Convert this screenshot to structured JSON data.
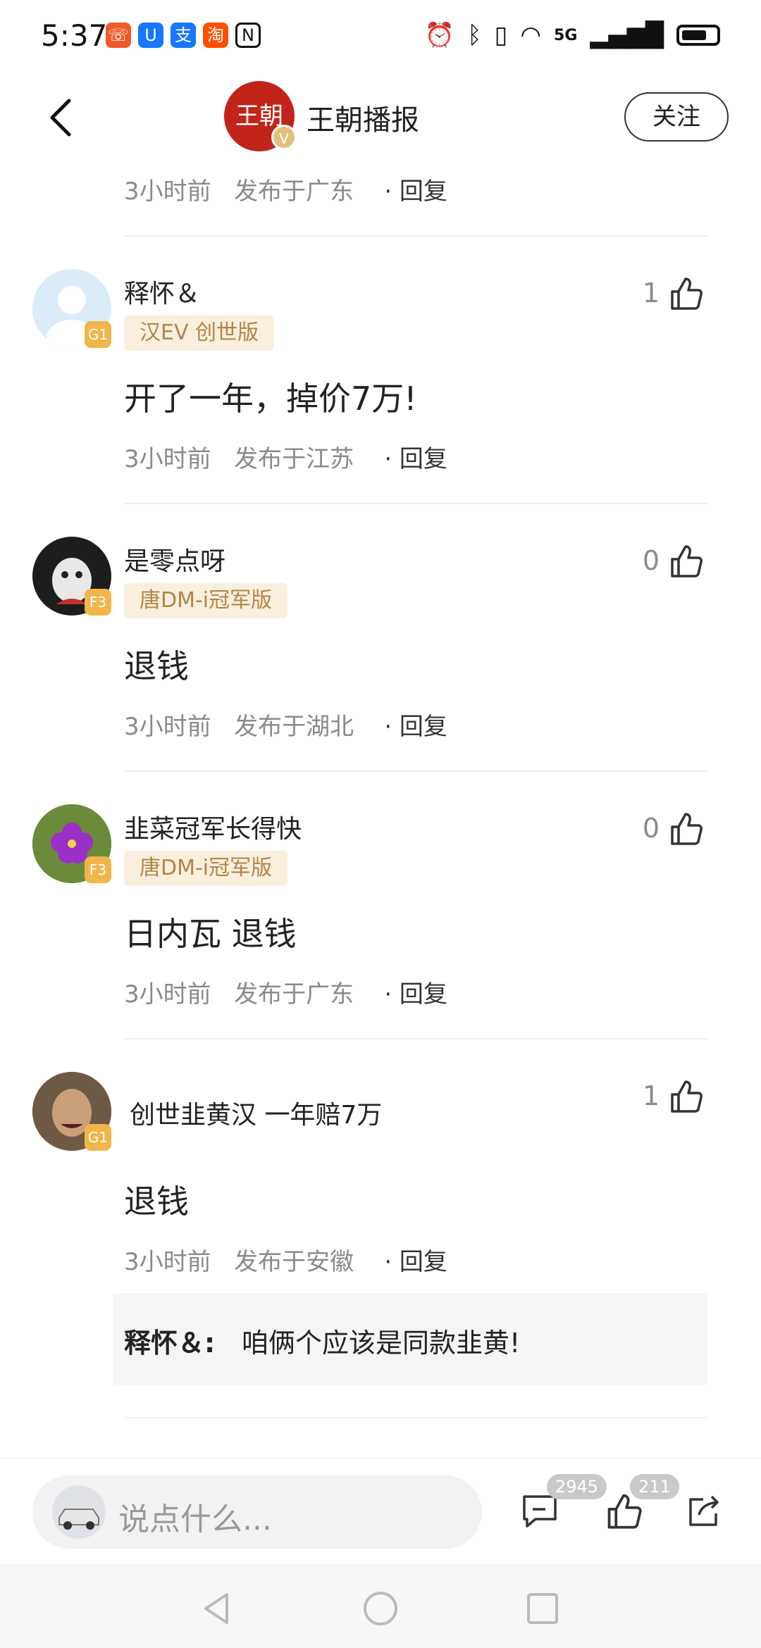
{
  "status_bar": {
    "time": "5:37",
    "network": "5G"
  },
  "header": {
    "author_name": "王朝播报",
    "avatar_text": "王朝",
    "badge": "V",
    "follow_label": "关注"
  },
  "comments": [
    {
      "username": "",
      "car_tag": "",
      "text": "",
      "time": "3小时前",
      "location": "发布于广东",
      "reply_label": "· 回复",
      "likes": ""
    },
    {
      "username": "释怀＆",
      "level": "G1",
      "car_tag": "汉EV 创世版",
      "text": "开了一年，掉价7万!",
      "time": "3小时前",
      "location": "发布于江苏",
      "reply_label": "· 回复",
      "likes": "1"
    },
    {
      "username": "是零点呀",
      "level": "F3",
      "car_tag": "唐DM-i冠军版",
      "text": "退钱",
      "time": "3小时前",
      "location": "发布于湖北",
      "reply_label": "· 回复",
      "likes": "0"
    },
    {
      "username": "韭菜冠军长得快",
      "level": "F3",
      "car_tag": "唐DM-i冠军版",
      "text": "日内瓦 退钱",
      "time": "3小时前",
      "location": "发布于广东",
      "reply_label": "· 回复",
      "likes": "0"
    },
    {
      "username": "创世韭黄汉 一年赔7万",
      "level": "G1",
      "car_tag": "",
      "text": "退钱",
      "time": "3小时前",
      "location": "发布于安徽",
      "reply_label": "· 回复",
      "likes": "1"
    }
  ],
  "nested_reply": {
    "author": "释怀＆:",
    "text": "咱俩个应该是同款韭黄!"
  },
  "bottom_bar": {
    "placeholder": "说点什么...",
    "comment_count": "2945",
    "like_count": "211"
  },
  "colors": {
    "brand_red": "#c32419",
    "tag_bg": "#f8efde",
    "tag_text": "#b28545",
    "level_badge": "#f0b64a"
  }
}
